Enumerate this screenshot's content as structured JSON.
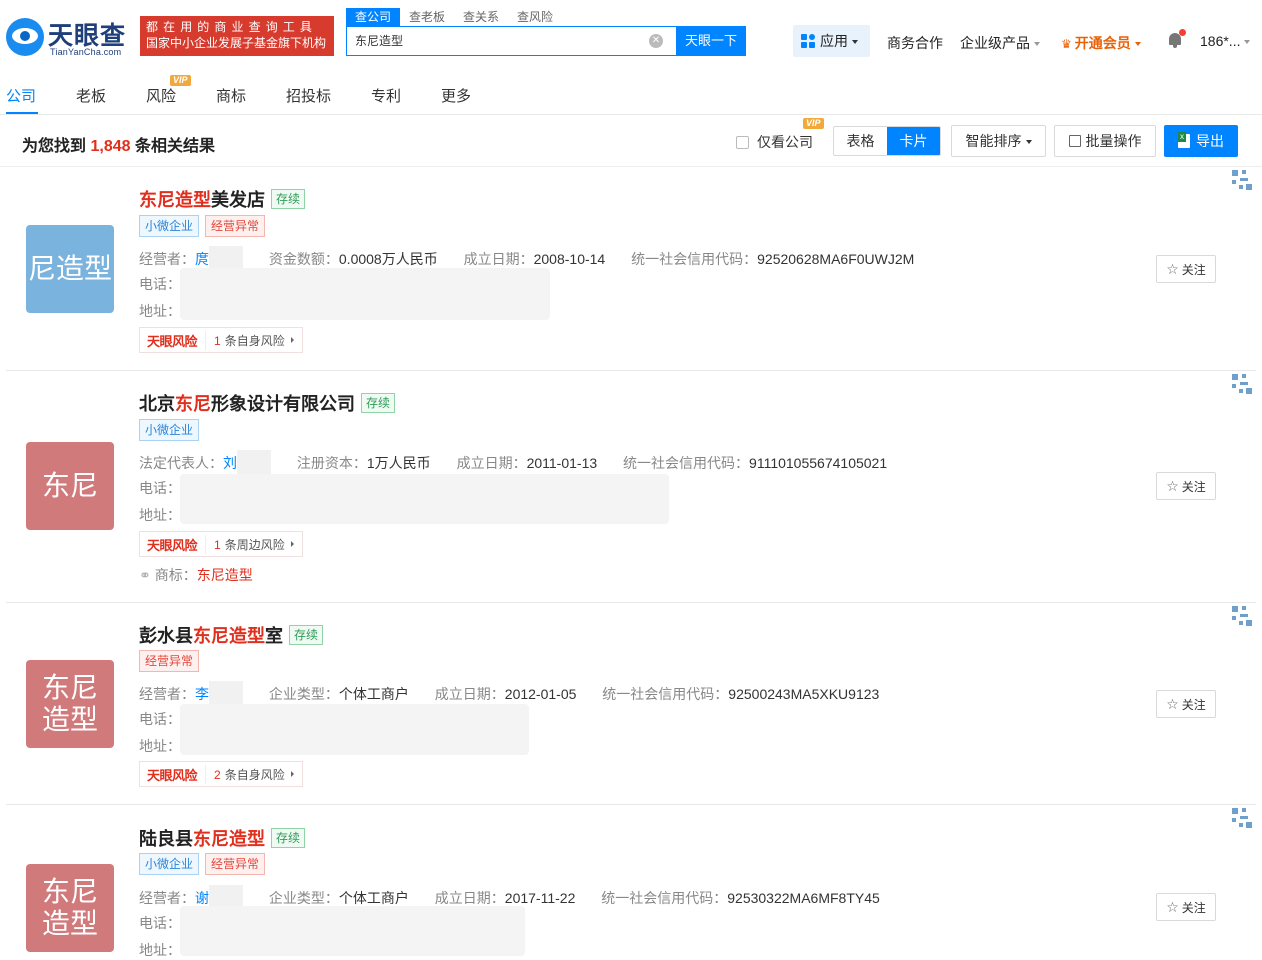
{
  "brand": {
    "name_cn": "天眼查",
    "name_en": "TianYanCha.com",
    "slogan_line1": "都在用的商业查询工具",
    "slogan_line2": "国家中小企业发展子基金旗下机构"
  },
  "search": {
    "tabs": [
      "查公司",
      "查老板",
      "查关系",
      "查风险"
    ],
    "active_tab": "查公司",
    "value": "东尼造型",
    "button_label": "天眼一下"
  },
  "topnav": {
    "apps_label": "应用",
    "business_label": "商务合作",
    "enterprise_label": "企业级产品",
    "vip_label": "开通会员",
    "user_label": "186*..."
  },
  "categories": {
    "items": [
      "公司",
      "老板",
      "风险",
      "商标",
      "招投标",
      "专利",
      "更多"
    ],
    "active": "公司",
    "vip_badge": "VIP"
  },
  "results": {
    "prefix": "为您找到",
    "count": "1,848",
    "suffix": "条相关结果",
    "company_only_label": "仅看公司",
    "vip_badge": "VIP",
    "view_table": "表格",
    "view_card": "卡片",
    "sort_label": "智能排序",
    "batch_label": "批量操作",
    "export_label": "导出"
  },
  "cards": [
    {
      "avatar": "尼造型",
      "name_hl": "东尼造型",
      "name_rest": "美发店",
      "status": "存续",
      "tags": [
        "小微企业",
        "经营异常"
      ],
      "f1_key": "经营者：",
      "f1_val": "庹",
      "f2_key": "资金数额：",
      "f2_val": "0.0008万人民币",
      "f3_key": "成立日期：",
      "f3_val": "2008-10-14",
      "f4_key": "统一社会信用代码：",
      "f4_val": "92520628MA6F0UWJ2M",
      "phone_label": "电话：",
      "address_label": "地址：",
      "risk_logo": "天眼风险",
      "risk_count": "1",
      "risk_text": "条自身风险",
      "follow": "关注"
    },
    {
      "avatar": "东尼",
      "name_pre": "北京",
      "name_hl": "东尼",
      "name_rest": "形象设计有限公司",
      "status": "存续",
      "tags": [
        "小微企业"
      ],
      "f1_key": "法定代表人：",
      "f1_val": "刘",
      "f2_key": "注册资本：",
      "f2_val": "1万人民币",
      "f3_key": "成立日期：",
      "f3_val": "2011-01-13",
      "f4_key": "统一社会信用代码：",
      "f4_val": "911101055674105021",
      "phone_label": "电话：",
      "address_label": "地址：",
      "risk_logo": "天眼风险",
      "risk_count": "1",
      "risk_text": "条周边风险",
      "trademark_label": "商标：",
      "trademark_val": "东尼造型",
      "follow": "关注"
    },
    {
      "avatar_l1": "东尼",
      "avatar_l2": "造型",
      "name_pre": "彭水县",
      "name_hl": "东尼造型",
      "name_rest": "室",
      "status": "存续",
      "tags": [
        "经营异常"
      ],
      "f1_key": "经营者：",
      "f1_val": "李",
      "f2_key": "企业类型：",
      "f2_val": "个体工商户",
      "f3_key": "成立日期：",
      "f3_val": "2012-01-05",
      "f4_key": "统一社会信用代码：",
      "f4_val": "92500243MA5XKU9123",
      "phone_label": "电话：",
      "address_label": "地址：",
      "risk_logo": "天眼风险",
      "risk_count": "2",
      "risk_text": "条自身风险",
      "follow": "关注"
    },
    {
      "avatar_l1": "东尼",
      "avatar_l2": "造型",
      "name_pre": "陆良县",
      "name_hl": "东尼造型",
      "status": "存续",
      "tags": [
        "小微企业",
        "经营异常"
      ],
      "f1_key": "经营者：",
      "f1_val": "谢",
      "f2_key": "企业类型：",
      "f2_val": "个体工商户",
      "f3_key": "成立日期：",
      "f3_val": "2017-11-22",
      "f4_key": "统一社会信用代码：",
      "f4_val": "92530322MA6MF8TY45",
      "phone_label": "电话：",
      "address_label": "地址：",
      "follow": "关注"
    }
  ],
  "colors": {
    "accent": "#0084ff",
    "highlight": "#e12f1e",
    "vip": "#e8620a",
    "avatar_blue": "#7ab3dd",
    "avatar_red": "#d17a7c"
  }
}
